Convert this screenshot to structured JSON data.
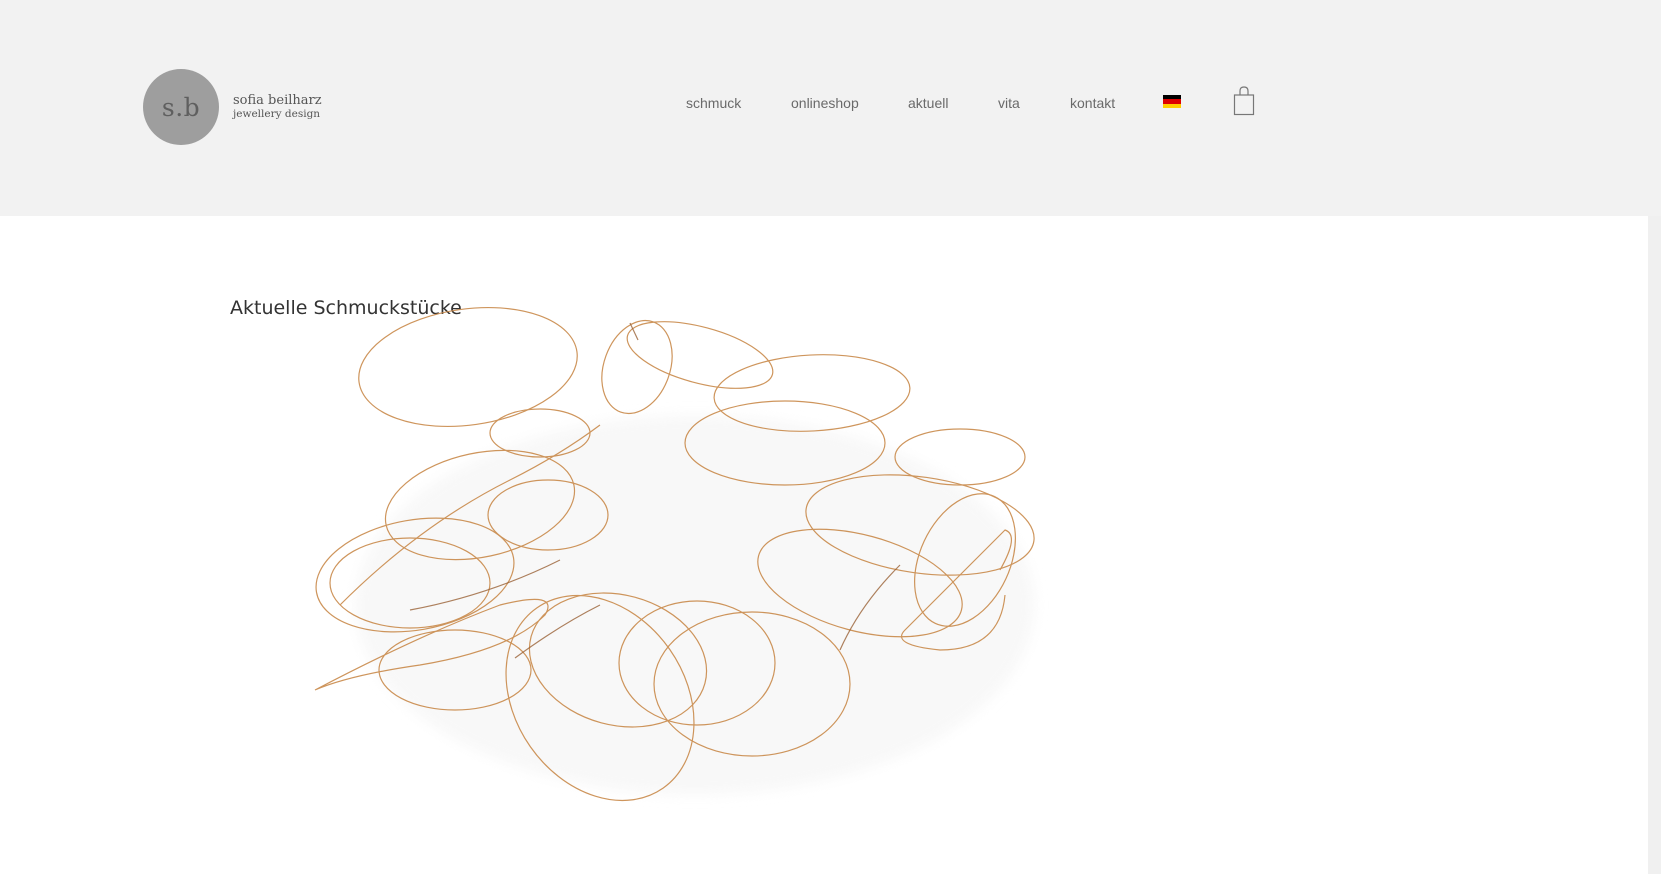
{
  "brand": {
    "monogram": "s.b",
    "name": "sofia beilharz",
    "tagline": "jewellery design"
  },
  "nav": {
    "items": [
      {
        "label": "schmuck"
      },
      {
        "label": "onlineshop"
      },
      {
        "label": "aktuell"
      },
      {
        "label": "vita"
      },
      {
        "label": "kontakt"
      }
    ],
    "language_flag": "flag-germany-icon",
    "cart_icon": "shopping-bag-icon"
  },
  "main": {
    "heading": "Aktuelle Schmuckstücke",
    "image_icon": "necklace-photo"
  },
  "colors": {
    "header_bg": "#f2f2f2",
    "logo_circle": "#9e9e9e",
    "nav_text": "#6a6a6a",
    "wire": "#c98a4b"
  }
}
